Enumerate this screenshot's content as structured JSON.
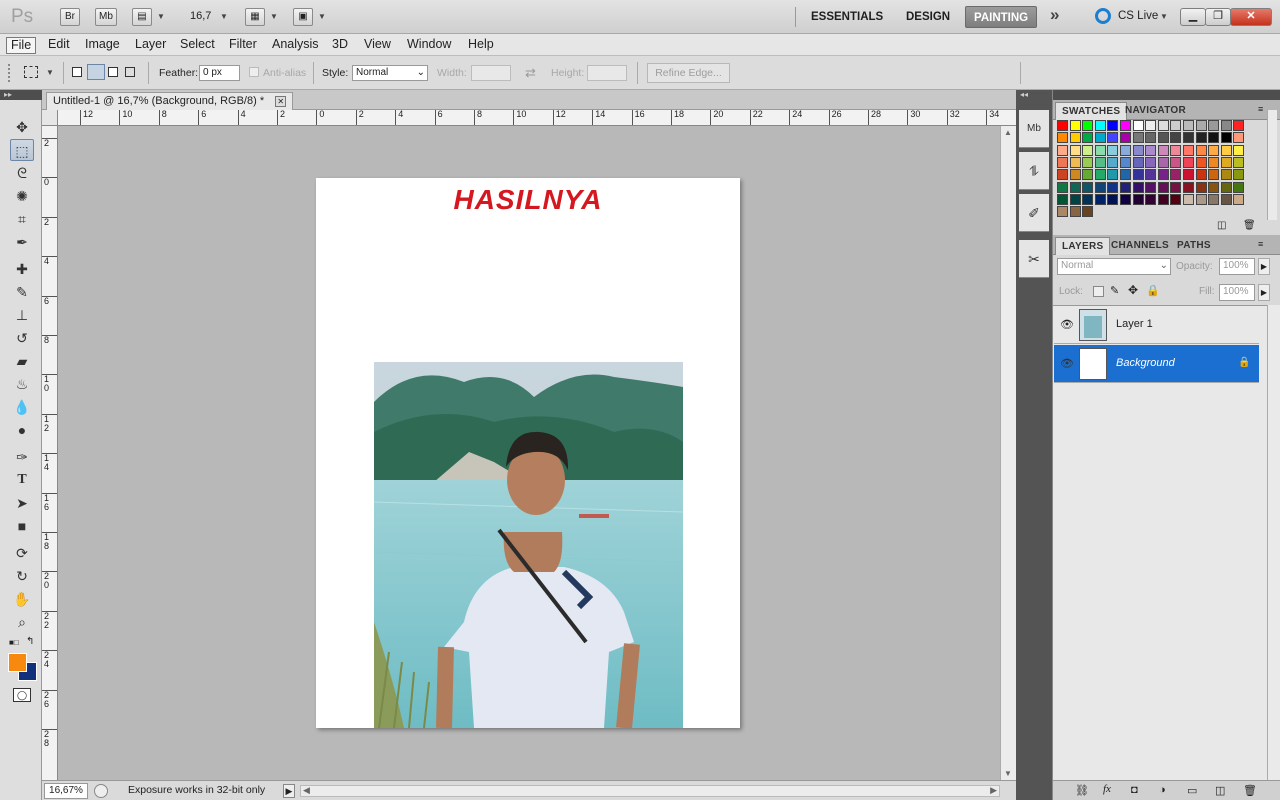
{
  "appbar": {
    "logo": "Ps",
    "bridge": "Br",
    "minibridge": "Mb",
    "zoom": "16,7",
    "workspaces": [
      "ESSENTIALS",
      "DESIGN",
      "PAINTING"
    ],
    "active_workspace": "PAINTING",
    "more": "»",
    "cslive": "CS Live"
  },
  "menubar": [
    "File",
    "Edit",
    "Image",
    "Layer",
    "Select",
    "Filter",
    "Analysis",
    "3D",
    "View",
    "Window",
    "Help"
  ],
  "options": {
    "feather_label": "Feather:",
    "feather_value": "0 px",
    "antialias_label": "Anti-alias",
    "style_label": "Style:",
    "style_value": "Normal",
    "width_label": "Width:",
    "height_label": "Height:",
    "refine_edge": "Refine Edge..."
  },
  "document": {
    "tab_title": "Untitled-1 @ 16,7% (Background, RGB/8) *",
    "heading": "HASILNYA",
    "ruler_h": [
      "12",
      "10",
      "8",
      "6",
      "4",
      "2",
      "0",
      "2",
      "4",
      "6",
      "8",
      "10",
      "12",
      "14",
      "16",
      "18",
      "20",
      "22",
      "24",
      "26",
      "28",
      "30",
      "32",
      "34"
    ],
    "ruler_v": [
      "2",
      "0",
      "2",
      "4",
      "6",
      "8",
      "1\n0",
      "1\n2",
      "1\n4",
      "1\n6",
      "1\n8",
      "2\n0",
      "2\n2",
      "2\n4",
      "2\n6",
      "2\n8"
    ]
  },
  "status": {
    "zoom": "16,67%",
    "text": "Exposure works in 32-bit only"
  },
  "swatches_panel": {
    "tabs": [
      "SWATCHES",
      "NAVIGATOR"
    ]
  },
  "layers_panel": {
    "tabs": [
      "LAYERS",
      "CHANNELS",
      "PATHS"
    ],
    "blend_mode": "Normal",
    "opacity_label": "Opacity:",
    "opacity": "100%",
    "lock_label": "Lock:",
    "fill_label": "Fill:",
    "fill": "100%",
    "layers": [
      {
        "name": "Layer 1",
        "selected": false
      },
      {
        "name": "Background",
        "selected": true
      }
    ]
  },
  "colors": {
    "foreground": "#f7890f",
    "background": "#13307a",
    "heading": "#d5171f",
    "selection": "#1a6fd0"
  }
}
